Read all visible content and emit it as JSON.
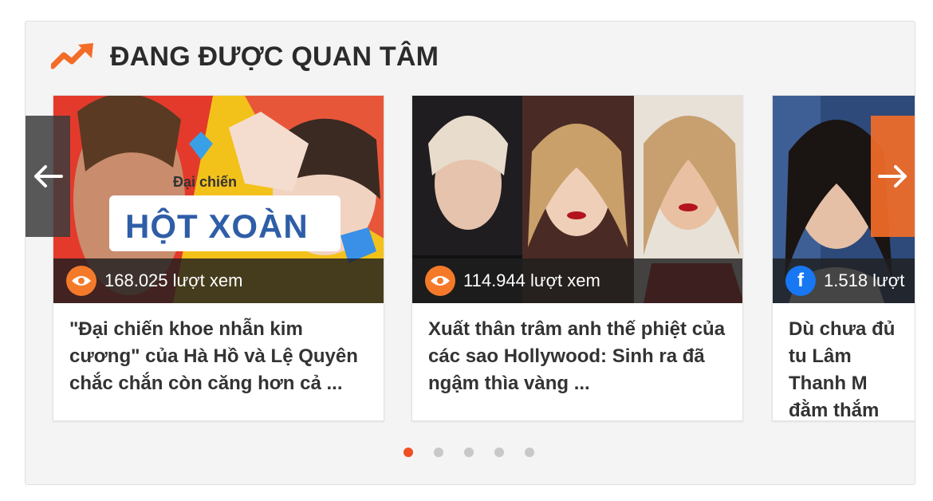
{
  "section": {
    "title": "ĐANG ĐƯỢC QUAN TÂM",
    "icon": "trending-up-icon",
    "accent_color": "#f36c28"
  },
  "cards": [
    {
      "views": "168.025 lượt xem",
      "views_icon": "eye-icon",
      "image_text_small": "Đại chiến",
      "image_text_big": "HỘT XOÀN",
      "title": "\"Đại chiến khoe nhẫn kim cương\" của Hà Hồ và Lệ Quyên chắc chắn còn căng hơn cả ..."
    },
    {
      "views": "114.944 lượt xem",
      "views_icon": "eye-icon",
      "title": "Xuất thân trâm anh thế phiệt của các sao Hollywood: Sinh ra đã ngậm thìa vàng ..."
    },
    {
      "views": "1.518 lượt",
      "views_icon": "facebook-icon",
      "title": "Dù chưa đủ tu Lâm Thanh M đằm thắm trê"
    }
  ],
  "pagination": {
    "pages": 5,
    "active": 1,
    "active_color": "#f04e23",
    "inactive_color": "#c8c8c8"
  }
}
